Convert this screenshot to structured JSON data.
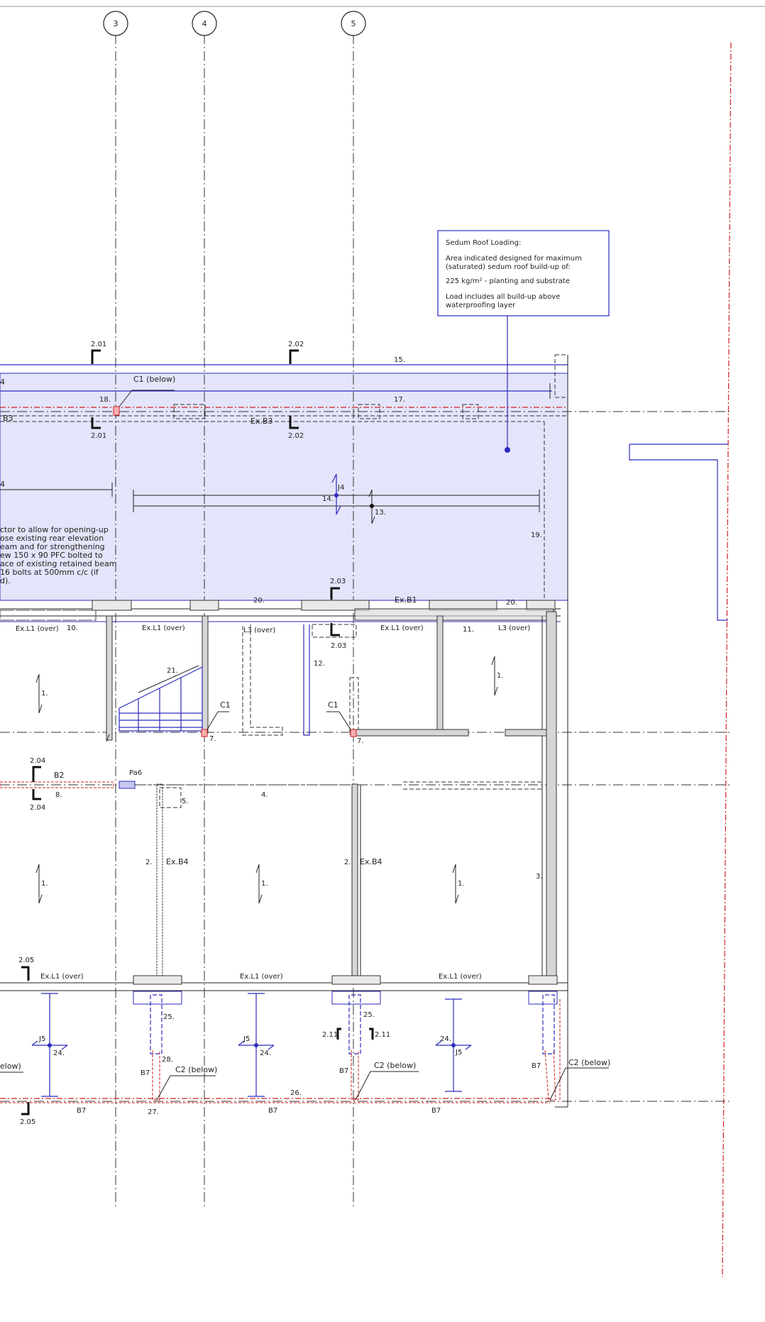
{
  "grid_bubbles": [
    "3",
    "4",
    "5"
  ],
  "sedum_note": {
    "title": "Sedum Roof Loading:",
    "line1": "Area indicated designed for maximum",
    "line2": "(saturated) sedum roof build-up of:",
    "line3": "225 kg/m² - planting and substrate",
    "line4": "Load includes all build-up above",
    "line5": "waterproofing layer"
  },
  "left_note": [
    "ctor to allow for opening-up",
    "ose existing rear elevation",
    "eam and for strengthening",
    "ew 150 x 90 PFC bolted to",
    "ace of existing retained beam",
    "16 bolts at 500mm c/c (if",
    "d)."
  ],
  "section_marks": {
    "s201": "2.01",
    "s202": "2.02",
    "s203": "2.03",
    "s204": "2.04",
    "s205": "2.05",
    "s211": "2.11"
  },
  "labels": {
    "c1_below": "C1 (below)",
    "c2_below": "C2 (below)",
    "c1": "C1",
    "ex_b3": "Ex.B3",
    "b3": "B3",
    "ex_b1": "Ex.B1",
    "ex_b4": "Ex.B4",
    "b2": "B2",
    "b7": "B7",
    "pa6": "Pa6",
    "j4": "J4",
    "j5": "J5",
    "ex_l1_over": "Ex.L1 (over)",
    "l3_over": "L3 (over)",
    "fragment_elow": "elow)",
    "fragment_4": "4"
  },
  "member_numbers": {
    "n1": "1.",
    "n2": "2.",
    "n3": "3.",
    "n4": "4.",
    "n5": "5.",
    "n7": "7.",
    "n8": "8.",
    "n10": "10.",
    "n11": "11.",
    "n12": "12.",
    "n13": "13.",
    "n14": "14.",
    "n15": "15.",
    "n17": "17.",
    "n18": "18.",
    "n19": "19.",
    "n20": "20.",
    "n21": "21.",
    "n24": "24.",
    "n25": "25.",
    "n26": "26.",
    "n27": "27.",
    "n28": "28."
  },
  "colors": {
    "sedum_fill": "#e4e4fa",
    "blue": "#2b2bbd",
    "red": "#d02020",
    "line": "#222222"
  }
}
